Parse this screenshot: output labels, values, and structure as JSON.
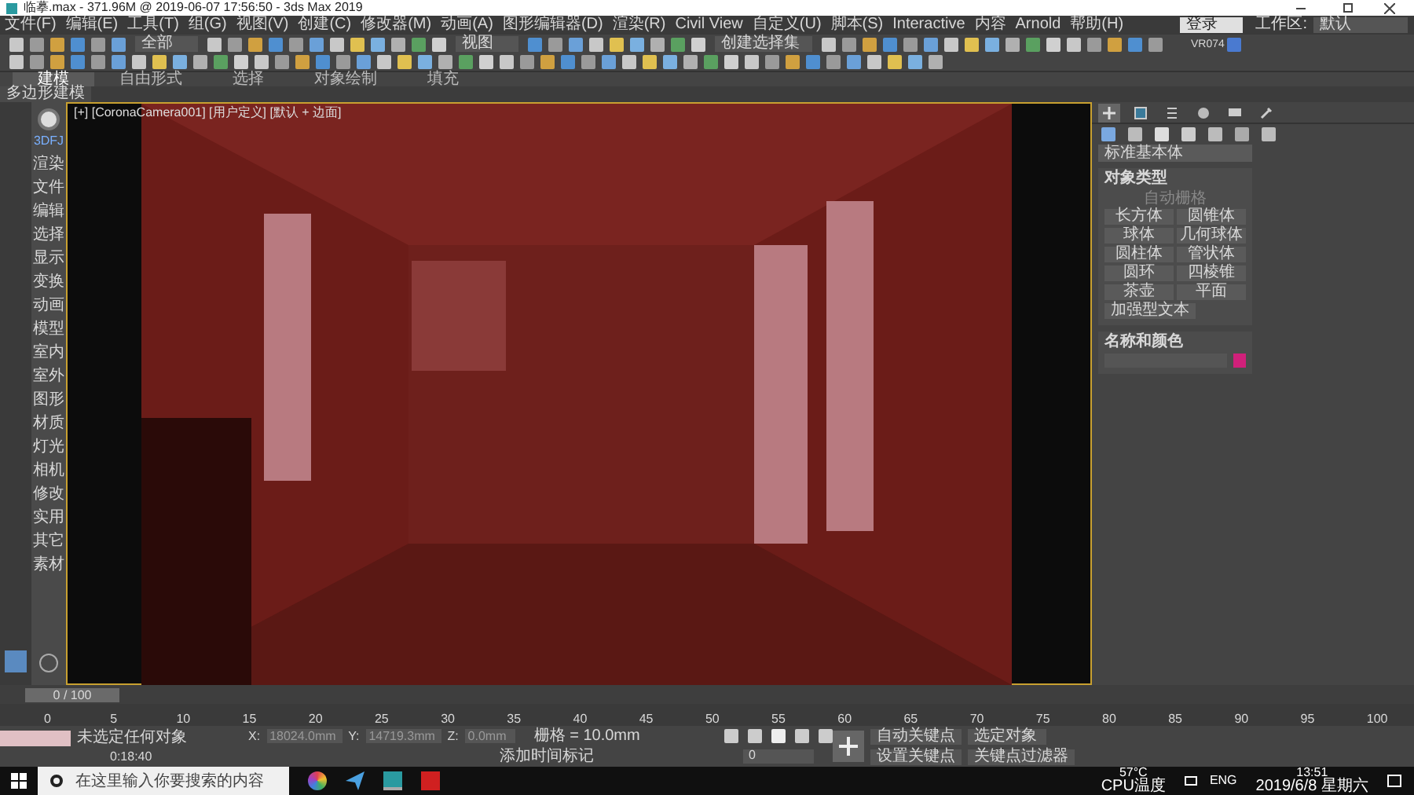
{
  "window": {
    "title": "临摹.max - 371.96M @ 2019-06-07 17:56:50 - 3ds Max 2019"
  },
  "menu": [
    "文件(F)",
    "编辑(E)",
    "工具(T)",
    "组(G)",
    "视图(V)",
    "创建(C)",
    "修改器(M)",
    "动画(A)",
    "图形编辑器(D)",
    "渲染(R)",
    "Civil View",
    "自定义(U)",
    "脚本(S)",
    "Interactive",
    "内容",
    "Arnold",
    "帮助(H)"
  ],
  "account": {
    "label": "登录"
  },
  "workspace": {
    "label": "工作区:",
    "value": "默认"
  },
  "toolbar": {
    "selection_filter": "全部",
    "coordinate": "视图",
    "selection_set": "创建选择集",
    "plugin_label": "VR074"
  },
  "ribbon": {
    "tabs": [
      {
        "label": "建模",
        "selected": true
      },
      {
        "label": "自由形式",
        "selected": false
      },
      {
        "label": "选择",
        "selected": false
      },
      {
        "label": "对象绘制",
        "selected": false
      },
      {
        "label": "填充",
        "selected": false
      }
    ],
    "panel": "多边形建模"
  },
  "sidebar": {
    "header": "3DFJ",
    "items": [
      "渲染",
      "文件",
      "编辑",
      "选择",
      "显示",
      "变换",
      "动画",
      "模型",
      "室内",
      "室外",
      "图形",
      "材质",
      "灯光",
      "相机",
      "修改",
      "实用",
      "其它",
      "素材"
    ]
  },
  "viewport": {
    "label": "[+] [CoronaCamera001] [用户定义] [默认 + 边面]"
  },
  "command_panel": {
    "tabs": [
      {
        "kind": "create",
        "selected": true
      },
      {
        "kind": "modify",
        "selected": false
      },
      {
        "kind": "hierarchy",
        "selected": false
      },
      {
        "kind": "motion",
        "selected": false
      },
      {
        "kind": "display",
        "selected": false
      },
      {
        "kind": "utilities",
        "selected": false
      }
    ],
    "category": "标准基本体",
    "object_type": {
      "title": "对象类型",
      "autogrid": {
        "label": "自动栅格",
        "checked": false
      },
      "buttons": [
        "长方体",
        "圆锥体",
        "球体",
        "几何球体",
        "圆柱体",
        "管状体",
        "圆环",
        "四棱锥",
        "茶壶",
        "平面",
        "加强型文本"
      ]
    },
    "name_color": {
      "title": "名称和颜色",
      "color": "#d0207a"
    }
  },
  "time_slider": {
    "reading": "0 / 100",
    "level": 0
  },
  "track": {
    "ticks": [
      "0",
      "5",
      "10",
      "15",
      "20",
      "25",
      "30",
      "35",
      "40",
      "45",
      "50",
      "55",
      "60",
      "65",
      "70",
      "75",
      "80",
      "85",
      "90",
      "95",
      "100"
    ]
  },
  "status": {
    "message": "未选定任何对象",
    "time": "0:18:40",
    "x_label": "X:",
    "y_label": "Y:",
    "z_label": "Z:",
    "x": "18024.0mm",
    "y": "14719.3mm",
    "z": "0.0mm",
    "grid": "栅格 = 10.0mm",
    "add_time_tag": "添加时间标记",
    "frame": "0",
    "auto_key": {
      "label": "自动关键点",
      "on": false
    },
    "key_target": "选定对象",
    "set_key": "设置关键点",
    "key_filters": "关键点过滤器"
  },
  "taskbar": {
    "search_placeholder": "在这里输入你要搜索的内容",
    "temp": "57°C",
    "temp_label": "CPU温度",
    "lang": "ENG",
    "time": "13:51",
    "date": "2019/6/8 星期六"
  }
}
